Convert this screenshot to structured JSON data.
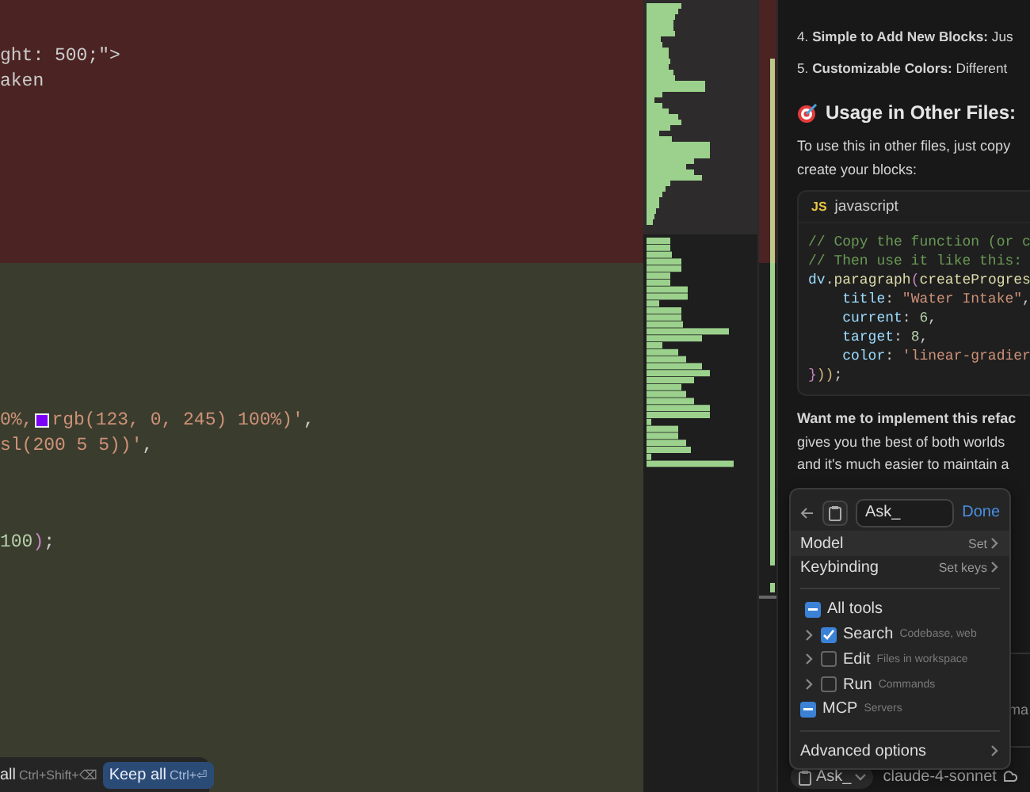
{
  "editor": {
    "removed_lines": [
      [
        {
          "kind": "plain",
          "text": "ght: 500;\">"
        }
      ],
      [
        {
          "kind": "plain",
          "text": "aken"
        }
      ]
    ],
    "added_lines": [
      [
        {
          "kind": "string",
          "text": "0%,"
        },
        {
          "kind": "swatch",
          "color": "#7b00f5"
        },
        {
          "kind": "string",
          "text": "rgb(123, 0, 245) 100%)'"
        },
        {
          "kind": "plain",
          "text": ","
        }
      ],
      [
        {
          "kind": "string",
          "text": "sl(200 5 5))'"
        },
        {
          "kind": "plain",
          "text": ","
        }
      ],
      [
        {
          "kind": "number",
          "text": "100"
        },
        {
          "kind": "bracket",
          "text": ")"
        },
        {
          "kind": "plain",
          "text": ";"
        }
      ]
    ]
  },
  "diff_bar": {
    "reject_label": "all",
    "reject_keys": "Ctrl+Shift+⌫",
    "keep_label": "Keep all",
    "keep_keys": "Ctrl+⏎"
  },
  "chat": {
    "list_items": [
      {
        "number": "4.",
        "title": "Simple to Add New Blocks:",
        "text": "Jus"
      },
      {
        "number": "5.",
        "title": "Customizable Colors:",
        "text": "Different"
      }
    ],
    "heading": "Usage in Other Files:",
    "intro_lines": [
      "To use this in other files, just copy",
      "create your blocks:"
    ],
    "code_block": {
      "badge": "JS",
      "language": "javascript",
      "lines": [
        [
          {
            "kind": "comment",
            "text": "// Copy the function (or c"
          }
        ],
        [
          {
            "kind": "comment",
            "text": "// Then use it like this:"
          }
        ],
        [
          {
            "kind": "object",
            "text": "dv"
          },
          {
            "kind": "plain",
            "text": "."
          },
          {
            "kind": "function",
            "text": "paragraph"
          },
          {
            "kind": "bracket",
            "text": "("
          },
          {
            "kind": "function",
            "text": "createProgres"
          }
        ],
        [
          {
            "kind": "prop",
            "text": "    title"
          },
          {
            "kind": "plain",
            "text": ": "
          },
          {
            "kind": "string",
            "text": "\"Water Intake\""
          },
          {
            "kind": "plain",
            "text": ","
          }
        ],
        [
          {
            "kind": "prop",
            "text": "    current"
          },
          {
            "kind": "plain",
            "text": ": "
          },
          {
            "kind": "number",
            "text": "6"
          },
          {
            "kind": "plain",
            "text": ","
          }
        ],
        [
          {
            "kind": "prop",
            "text": "    target"
          },
          {
            "kind": "plain",
            "text": ": "
          },
          {
            "kind": "number",
            "text": "8"
          },
          {
            "kind": "plain",
            "text": ","
          }
        ],
        [
          {
            "kind": "prop",
            "text": "    color"
          },
          {
            "kind": "plain",
            "text": ": "
          },
          {
            "kind": "string",
            "text": "'linear-gradier"
          }
        ],
        [
          {
            "kind": "bracket",
            "text": "}"
          },
          {
            "kind": "bracket2",
            "text": "))"
          },
          {
            "kind": "plain",
            "text": ";"
          }
        ]
      ]
    },
    "outro_lines": [
      "**Want me to implement this refac**",
      "gives you the best of both worlds",
      "and it's much easier to maintain a"
    ],
    "composer_text": "ma",
    "mode": "Ask_",
    "model": "claude-4-sonnet"
  },
  "popup": {
    "name_value": "Ask_",
    "done": "Done",
    "settings": [
      {
        "label": "Model",
        "value": "Set"
      },
      {
        "label": "Keybinding",
        "value": "Set keys"
      }
    ],
    "tools": [
      {
        "kind": "group",
        "label": "All tools",
        "checked": true,
        "partial": true
      },
      {
        "kind": "tool",
        "label": "Search",
        "description": "Codebase, web",
        "checked": true,
        "expanded": false
      },
      {
        "kind": "tool",
        "label": "Edit",
        "description": "Files in workspace",
        "checked": false,
        "expanded": false
      },
      {
        "kind": "tool",
        "label": "Run",
        "description": "Commands",
        "checked": false,
        "expanded": false
      },
      {
        "kind": "group",
        "label": "MCP",
        "description": "Servers",
        "checked": true,
        "partial": true
      }
    ],
    "advanced": "Advanced options"
  }
}
